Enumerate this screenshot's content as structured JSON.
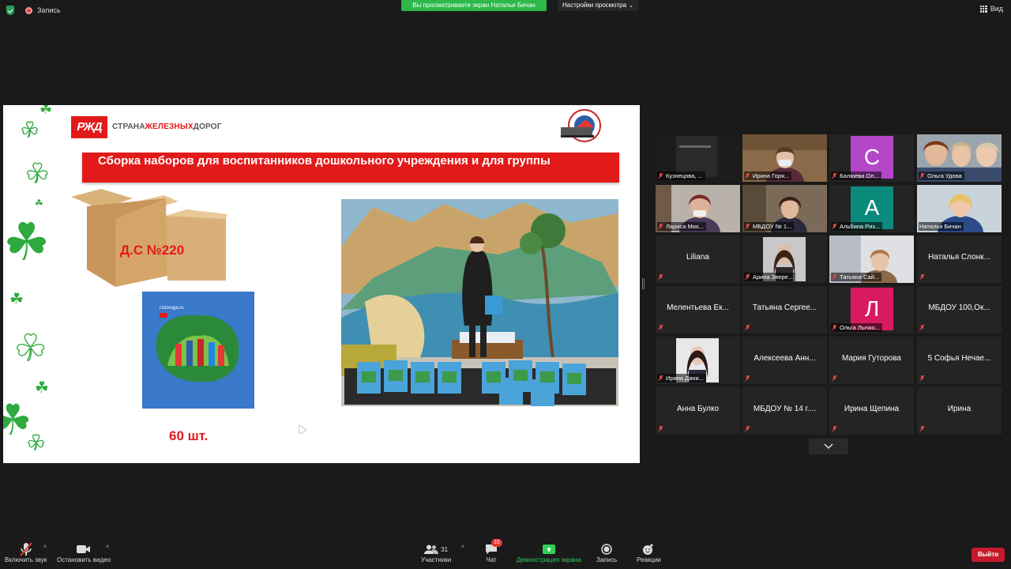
{
  "topbar": {
    "record_label": "Запись",
    "share_banner": "Вы просматриваете экран Натальи Бичан",
    "view_settings": "Настройки просмотра",
    "view_label": "Вид"
  },
  "slide": {
    "logo_rzd": "РЖД",
    "logo_text_start": "СТРАНА",
    "logo_text_red": "ЖЕЛЕЗНЫХ",
    "logo_text_end": "ДОРОГ",
    "title": "Сборка наборов для воспитанников дошкольного учреждения и для группы",
    "box_label": "Д.С №220",
    "quantity": "60 шт."
  },
  "gallery": {
    "tiles": [
      {
        "name": "Кузнецова, ...",
        "type": "video"
      },
      {
        "name": "Ирина Горя...",
        "type": "video"
      },
      {
        "name": "Балюева Ол...",
        "type": "avatar",
        "letter": "C",
        "color": "#b347c8"
      },
      {
        "name": "Ольга Удова",
        "type": "video"
      },
      {
        "name": "Лариса Мих...",
        "type": "video"
      },
      {
        "name": "МБДОУ № 1...",
        "type": "video"
      },
      {
        "name": "Альбина Риз...",
        "type": "avatar",
        "letter": "A",
        "color": "#0b8a7c"
      },
      {
        "name": "Наталья Бичан",
        "type": "video",
        "active": true
      },
      {
        "name": "Liliana",
        "type": "name"
      },
      {
        "name": "Арина Звере...",
        "type": "video"
      },
      {
        "name": "Татьяна Сай...",
        "type": "video"
      },
      {
        "name": "Наталья  Слонк...",
        "type": "name"
      },
      {
        "name": "Мелентьева  Ек...",
        "type": "name"
      },
      {
        "name": "Татьяна  Сергее...",
        "type": "name"
      },
      {
        "name": "Ольга Лычко...",
        "type": "avatar",
        "letter": "Л",
        "color": "#d81b60"
      },
      {
        "name": "МБДОУ 100,Ок...",
        "type": "name"
      },
      {
        "name": "Ирина Дани...",
        "type": "video"
      },
      {
        "name": "Алексеева  Анн...",
        "type": "name"
      },
      {
        "name": "Мария Гуторова",
        "type": "name"
      },
      {
        "name": "5 Софья  Нечае...",
        "type": "name"
      },
      {
        "name": "Анна Булко",
        "type": "name"
      },
      {
        "name": "МБДОУ № 14 г....",
        "type": "name"
      },
      {
        "name": "Ирина Щепина",
        "type": "name"
      },
      {
        "name": "Ирина",
        "type": "name"
      }
    ]
  },
  "toolbar": {
    "unmute": "Включить звук",
    "stop_video": "Остановить видео",
    "participants": "Участники",
    "participants_count": "31",
    "chat": "Чат",
    "chat_badge": "10",
    "share_screen": "Демонстрация экрана",
    "record": "Запись",
    "reactions": "Реакции",
    "leave": "Выйти"
  },
  "colors": {
    "share_banner": "#2db84a",
    "rzd_red": "#e21a1a",
    "active_speaker": "#b6f25a",
    "leave_button": "#c7192b"
  }
}
